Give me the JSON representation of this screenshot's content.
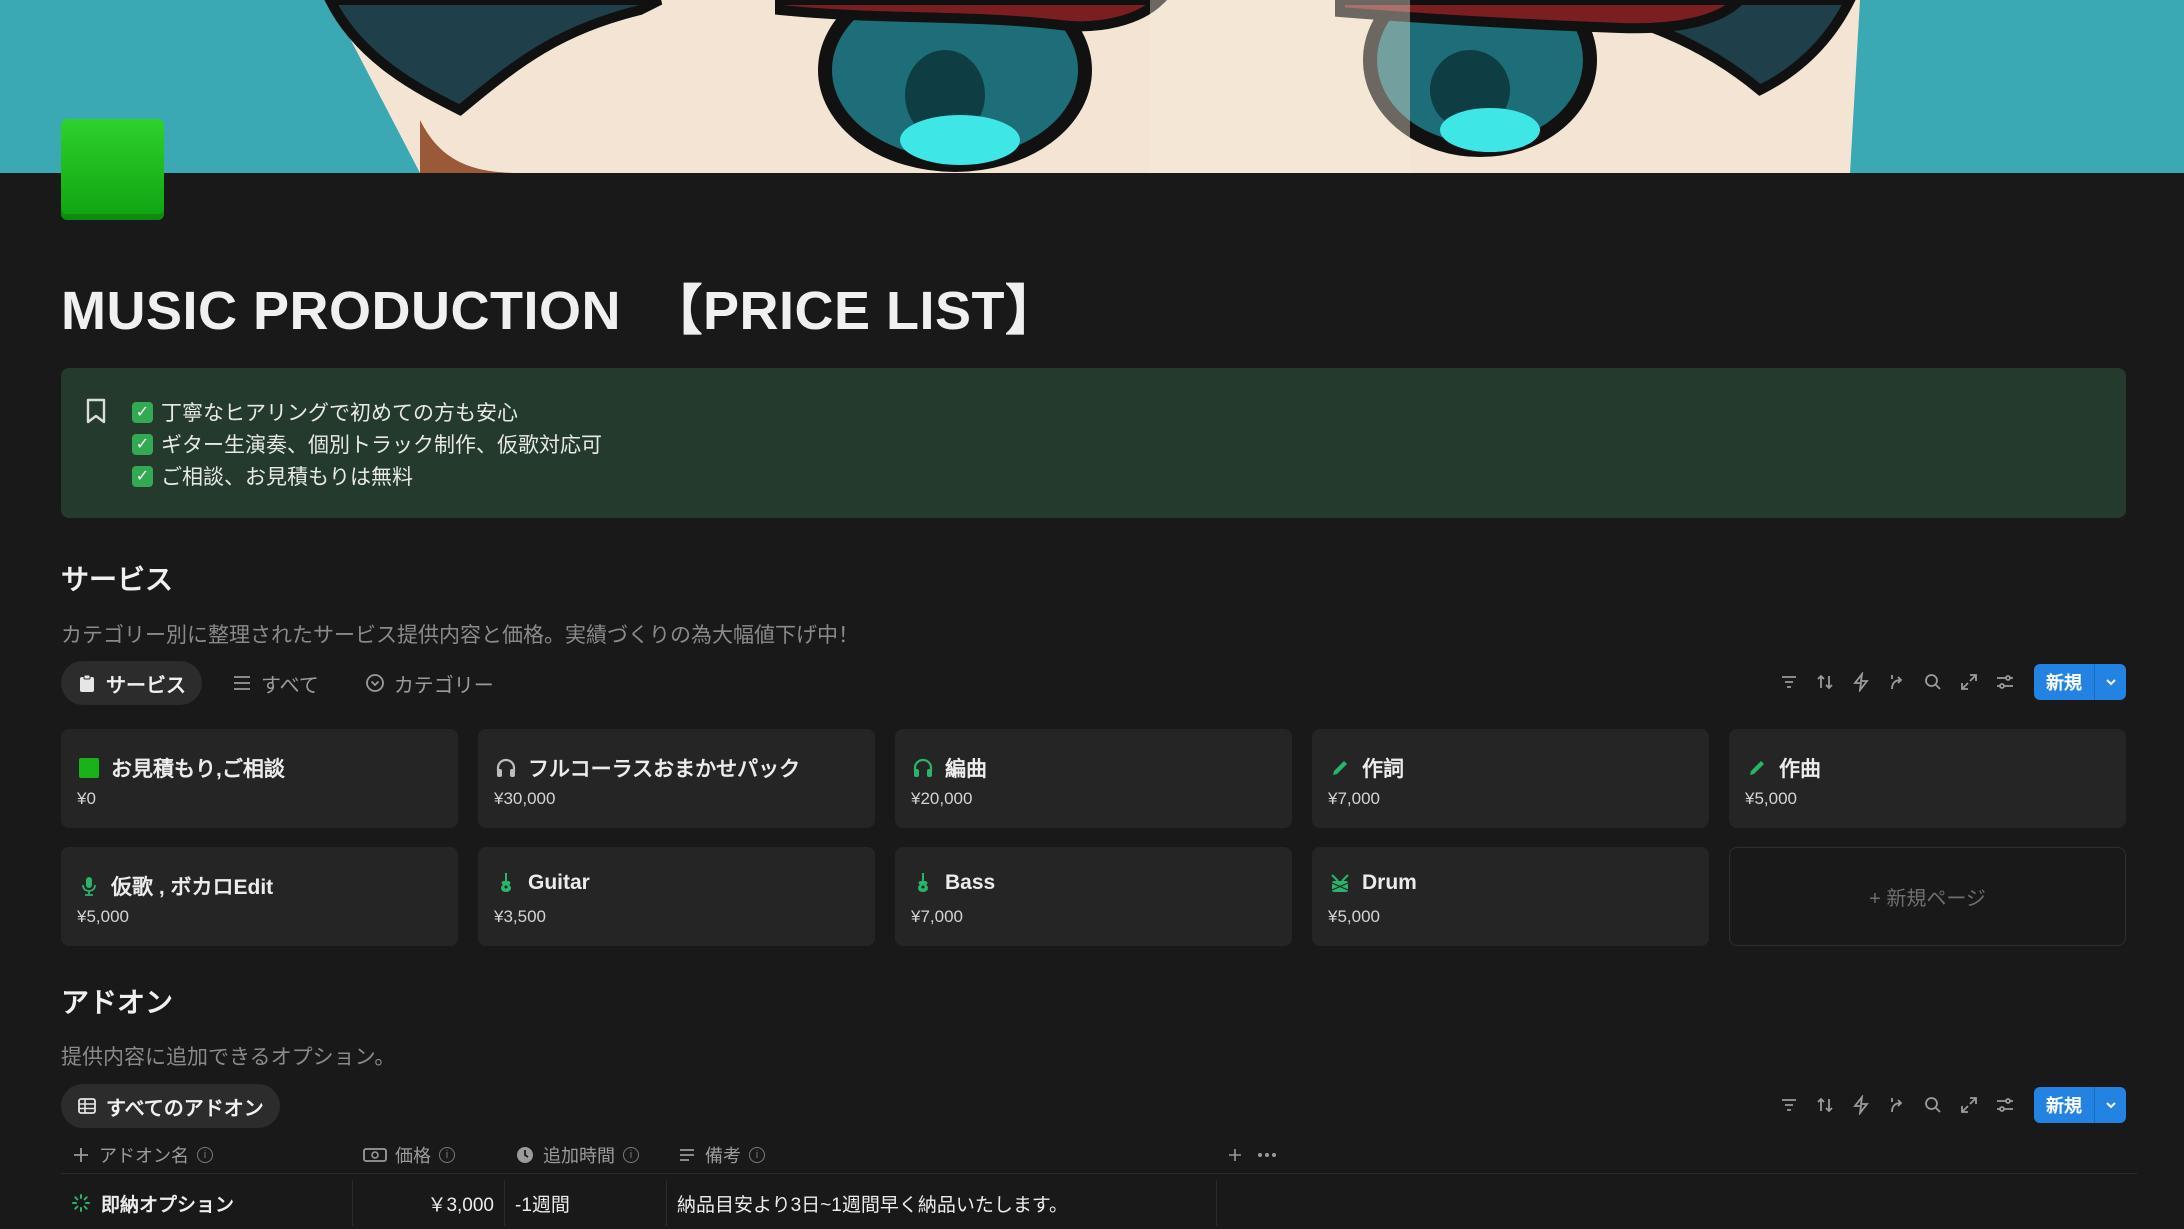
{
  "page": {
    "title": "MUSIC PRODUCTION　【PRICE LIST】"
  },
  "callout": {
    "lines": [
      "丁寧なヒアリングで初めての方も安心",
      "ギター生演奏、個別トラック制作、仮歌対応可",
      "ご相談、お見積もりは無料"
    ]
  },
  "services": {
    "title": "サービス",
    "description": "カテゴリー別に整理されたサービス提供内容と価格。実績づくりの為大幅値下げ中！",
    "tabs": [
      {
        "label": "サービス",
        "icon": "clipboard-icon"
      },
      {
        "label": "すべて",
        "icon": "list-icon"
      },
      {
        "label": "カテゴリー",
        "icon": "chevron-circle-icon"
      }
    ],
    "new_label": "新規",
    "cards": [
      {
        "title": "お見積もり,ご相談",
        "price": "¥0",
        "icon": "green-square-icon"
      },
      {
        "title": "フルコーラスおまかせパック",
        "price": "¥30,000",
        "icon": "headphones-icon"
      },
      {
        "title": "編曲",
        "price": "¥20,000",
        "icon": "headphones-icon"
      },
      {
        "title": "作詞",
        "price": "¥7,000",
        "icon": "pencil-icon"
      },
      {
        "title": "作曲",
        "price": "¥5,000",
        "icon": "pencil-icon"
      },
      {
        "title": "仮歌 , ボカロEdit",
        "price": "¥5,000",
        "icon": "microphone-icon"
      },
      {
        "title": "Guitar",
        "price": "¥3,500",
        "icon": "guitar-icon"
      },
      {
        "title": "Bass",
        "price": "¥7,000",
        "icon": "guitar-icon"
      },
      {
        "title": "Drum",
        "price": "¥5,000",
        "icon": "drum-icon"
      }
    ],
    "new_page_label": "+ 新規ページ"
  },
  "addons": {
    "title": "アドオン",
    "description": "提供内容に追加できるオプション。",
    "tab_label": "すべてのアドオン",
    "new_label": "新規",
    "columns": [
      "アドオン名",
      "価格",
      "追加時間",
      "備考"
    ],
    "rows": [
      {
        "name": "即納オプション",
        "price": "￥3,000",
        "time": "-1週間",
        "note": "納品目安より3日~1週間早く納品いたします。"
      }
    ]
  },
  "colors": {
    "accent": "#2383e2",
    "callout_bg": "#243a2c",
    "background": "#191919",
    "card_bg": "#252525"
  }
}
